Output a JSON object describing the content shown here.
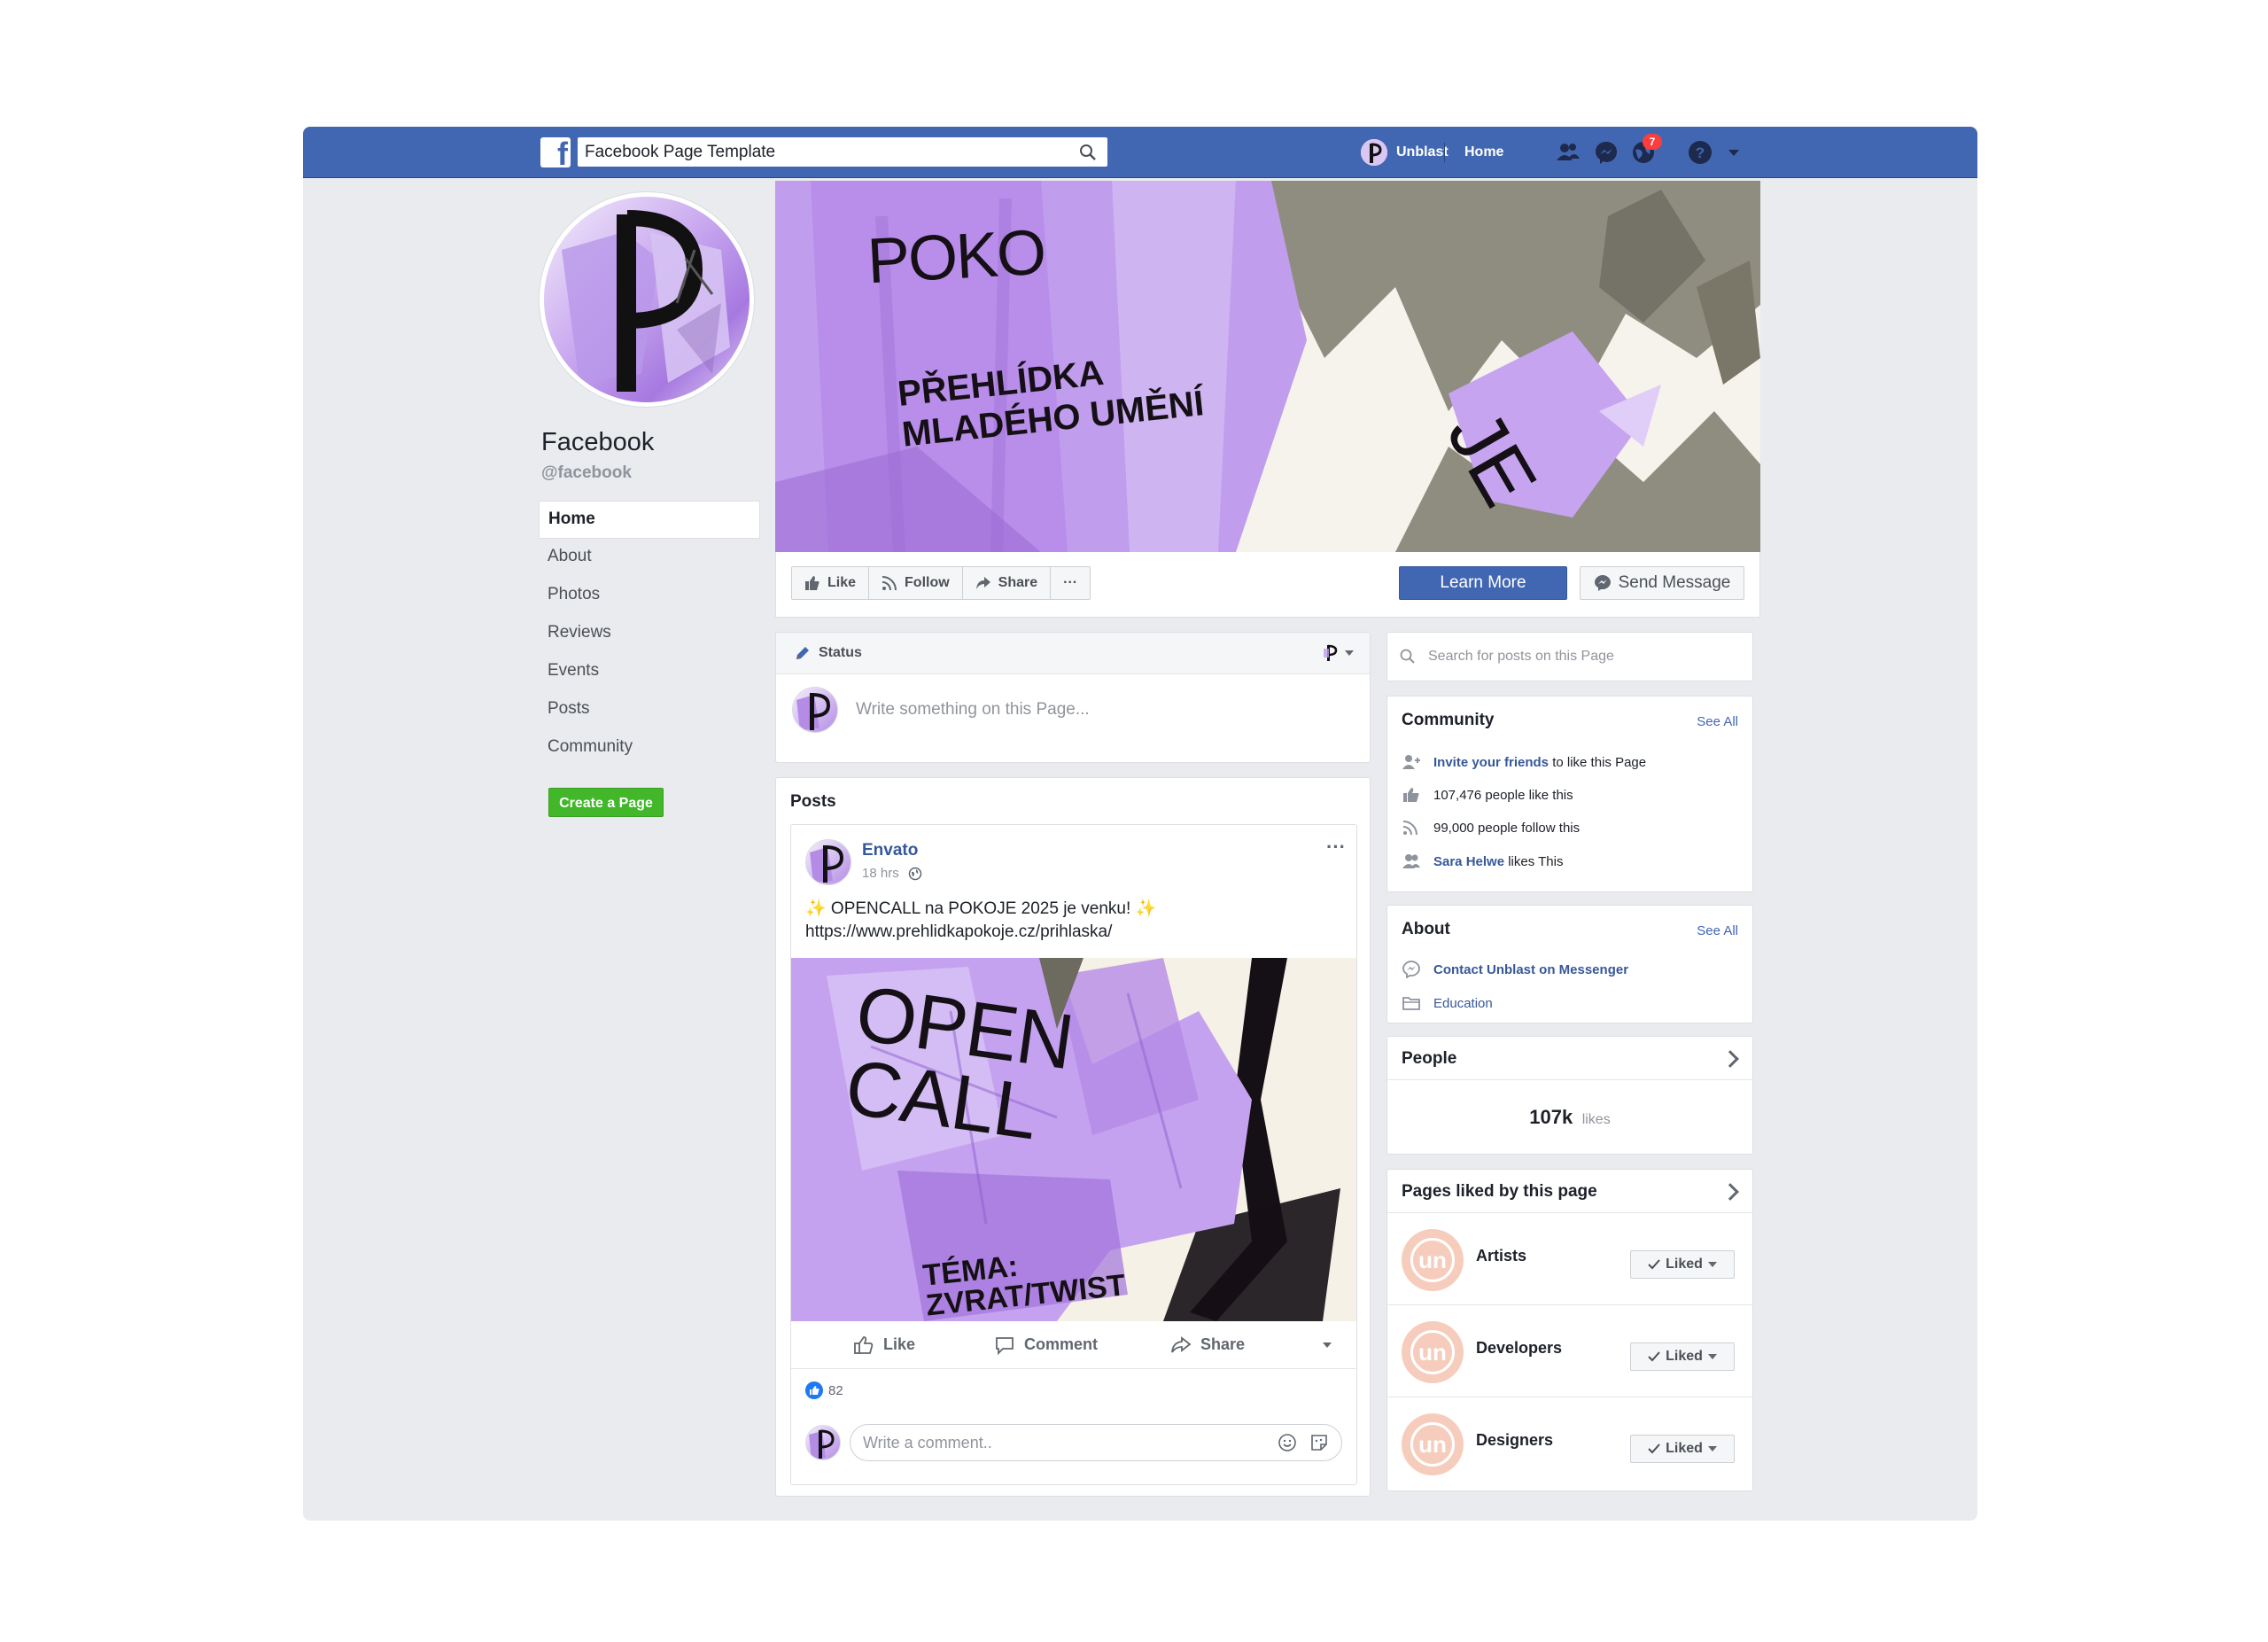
{
  "topbar": {
    "search_value": "Facebook Page Template",
    "user_name": "Unblast",
    "home_label": "Home",
    "notification_count": "7"
  },
  "page": {
    "name": "Facebook",
    "handle": "@facebook"
  },
  "nav": {
    "items": [
      "Home",
      "About",
      "Photos",
      "Reviews",
      "Events",
      "Posts",
      "Community"
    ],
    "create_page": "Create a Page"
  },
  "cover": {
    "title": "POKO",
    "subtitle_line1": "PŘEHLÍDKA",
    "subtitle_line2": "MLADÉHO UMĚNÍ",
    "side_text": "JE"
  },
  "actions": {
    "like": "Like",
    "follow": "Follow",
    "share": "Share",
    "more": "···",
    "learn_more": "Learn More",
    "send_message": "Send Message"
  },
  "status": {
    "label": "Status",
    "placeholder": "Write something on this Page..."
  },
  "posts": {
    "title": "Posts",
    "post": {
      "author": "Envato",
      "time": "18 hrs",
      "text_line1": "✨ OPENCALL na POKOJE 2025 je venku! ✨",
      "text_line2": "https://www.prehlidkapokoje.cz/prihlaska/",
      "image_text1": "OPEN",
      "image_text2": "CALL",
      "image_text3": "TÉMA:",
      "image_text4": "ZVRAT/TWIST",
      "like": "Like",
      "comment": "Comment",
      "share": "Share",
      "reaction_count": "82",
      "comment_placeholder": "Write a comment.."
    }
  },
  "sidebar": {
    "search_placeholder": "Search for posts on this Page",
    "community": {
      "title": "Community",
      "see_all": "See All",
      "invite_link": "Invite your friends",
      "invite_rest": "to like this Page",
      "likes": "107,476 people like this",
      "follows": "99,000 people follow this",
      "friend_name": "Sara Helwe",
      "friend_rest": "likes This"
    },
    "about": {
      "title": "About",
      "see_all": "See All",
      "messenger": "Contact Unblast on Messenger",
      "category": "Education"
    },
    "people": {
      "title": "People",
      "count": "107k",
      "unit": "likes"
    },
    "pages_liked": {
      "title": "Pages liked by this page",
      "button": "Liked",
      "logo_text": "un",
      "items": [
        "Artists",
        "Developers",
        "Designers"
      ]
    }
  },
  "colors": {
    "topbar": "#4267b2",
    "background": "#e9ebee",
    "link": "#365899",
    "create_page": "#42b72a",
    "lilac": "#b48ce6"
  }
}
